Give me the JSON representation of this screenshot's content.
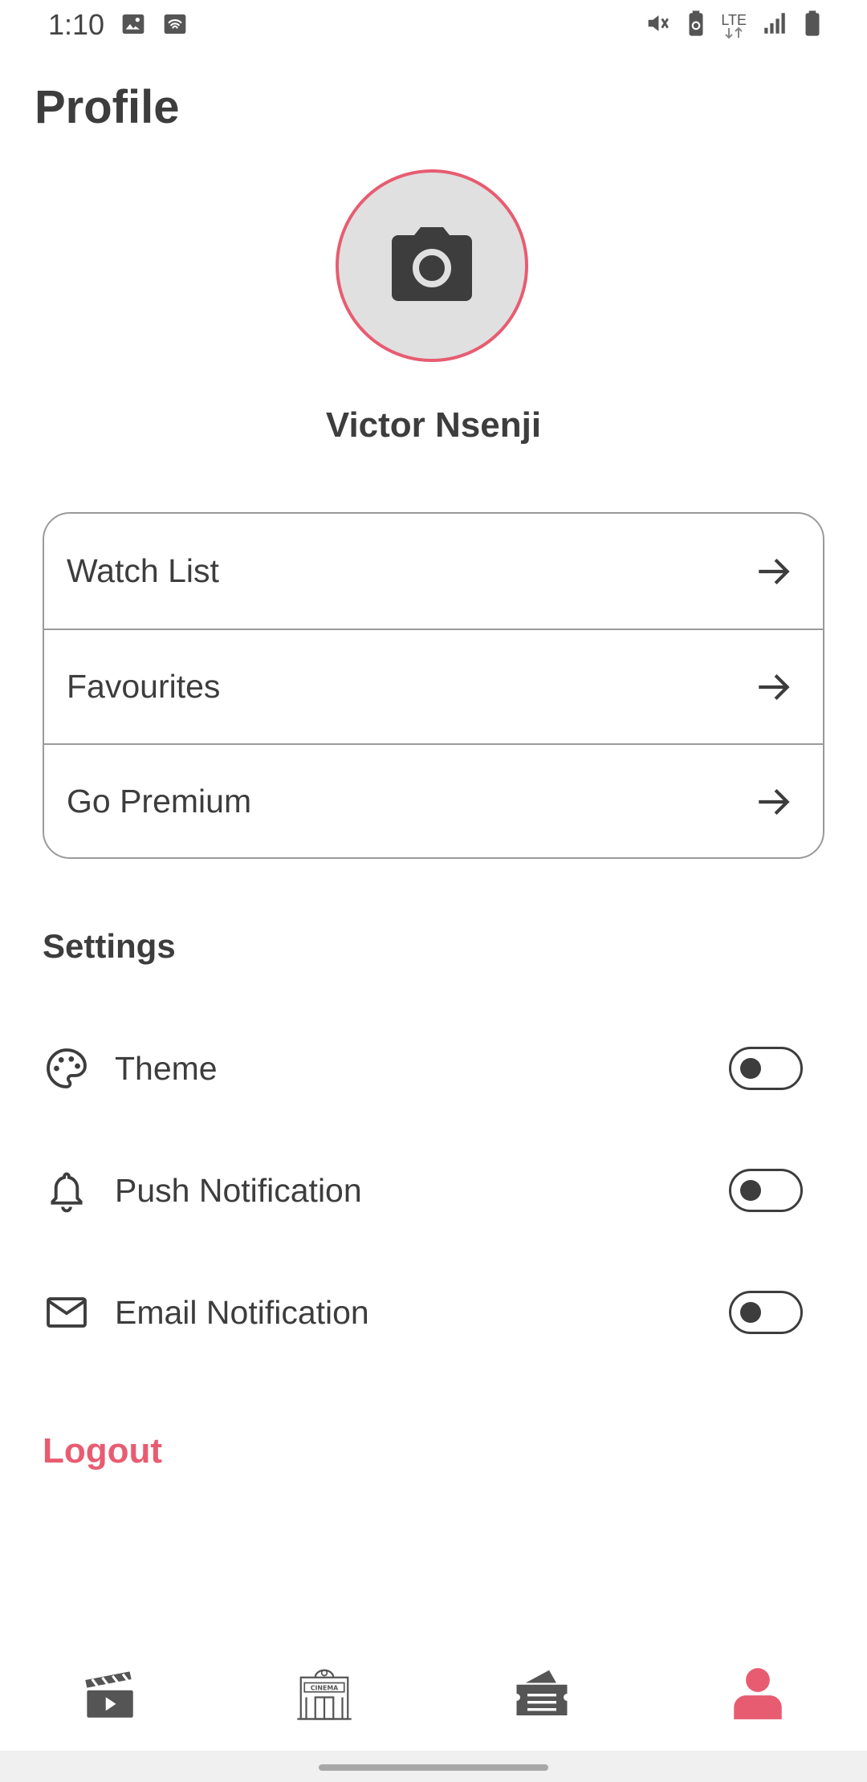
{
  "status_bar": {
    "time": "1:10",
    "network_label": "LTE",
    "icons": [
      "image-icon",
      "wifi-icon",
      "mute-icon",
      "battery-saver-icon",
      "lte-data-icon",
      "signal-icon",
      "battery-icon"
    ]
  },
  "header": {
    "title": "Profile"
  },
  "profile": {
    "name": "Victor Nsenji",
    "avatar_icon": "camera-icon",
    "accent_color": "#e85c71"
  },
  "menu": {
    "items": [
      {
        "label": "Watch List",
        "icon": "arrow-right-icon"
      },
      {
        "label": "Favourites",
        "icon": "arrow-right-icon"
      },
      {
        "label": "Go Premium",
        "icon": "arrow-right-icon"
      }
    ]
  },
  "settings": {
    "title": "Settings",
    "items": [
      {
        "label": "Theme",
        "icon": "palette-icon",
        "enabled": false
      },
      {
        "label": "Push Notification",
        "icon": "bell-icon",
        "enabled": false
      },
      {
        "label": "Email Notification",
        "icon": "mail-icon",
        "enabled": false
      }
    ]
  },
  "logout_label": "Logout",
  "bottom_nav": {
    "items": [
      {
        "icon": "clapperboard-icon",
        "active": false
      },
      {
        "icon": "cinema-icon",
        "active": false
      },
      {
        "icon": "tickets-icon",
        "active": false
      },
      {
        "icon": "person-icon",
        "active": true
      }
    ],
    "active_color": "#e85c71",
    "inactive_color": "#555555"
  }
}
